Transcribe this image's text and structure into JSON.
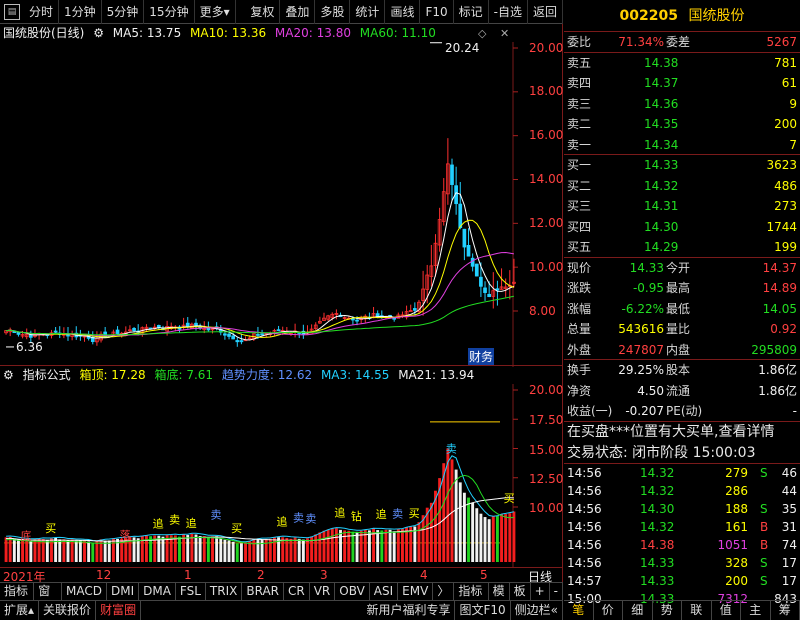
{
  "toolbar": {
    "items": [
      "分时",
      "1分钟",
      "5分钟",
      "15分钟",
      "更多",
      "复权",
      "叠加",
      "多股",
      "统计",
      "画线",
      "F10",
      "标记",
      "-自选",
      "返回"
    ]
  },
  "main_legend": {
    "title": "国统股份(日线)",
    "ma5": "MA5: 13.75",
    "ma10": "MA10: 13.36",
    "ma20": "MA20: 13.80",
    "ma60": "MA60: 11.10"
  },
  "main_axis": [
    "20.00",
    "18.00",
    "16.00",
    "14.00",
    "12.00",
    "10.00",
    "8.00"
  ],
  "main_annotations": {
    "high": "20.24",
    "low": "6.36",
    "badge": "财务"
  },
  "sub_legend": {
    "title": "指标公式",
    "top": "箱顶: 17.28",
    "bottom": "箱底: 7.61",
    "trend": "趋势力度: 12.62",
    "ma3": "MA3: 14.55",
    "ma21": "MA21: 13.94"
  },
  "sub_axis": [
    "20.00",
    "17.50",
    "15.00",
    "12.50",
    "10.00"
  ],
  "signals": {
    "buy": "买",
    "sell": "卖",
    "chase": "追",
    "outcome": "落",
    "bottom": "底",
    "diamond": "钻"
  },
  "time_axis": [
    "2021年",
    "12",
    "1",
    "2",
    "3",
    "4",
    "5"
  ],
  "time_axis_right": "日线",
  "tabs1": [
    "指标A",
    "窗口",
    "MACD",
    "DMI",
    "DMA",
    "FSL",
    "TRIX",
    "BRAR",
    "CR",
    "VR",
    "OBV",
    "ASI",
    "EMV",
    "〉",
    "指标B",
    "模",
    "板",
    "+",
    "-"
  ],
  "tabs2": [
    "扩展",
    "关联报价",
    "财富圈",
    "新用户福利专享",
    "图文F10",
    "侧边栏"
  ],
  "rpanel": {
    "code": "002205",
    "name": "国统股份",
    "weibi_label": "委比",
    "weibi": "71.34%",
    "weicha_label": "委差",
    "weicha": "5267",
    "sells": [
      {
        "label": "卖五",
        "price": "14.38",
        "vol": "781"
      },
      {
        "label": "卖四",
        "price": "14.37",
        "vol": "61"
      },
      {
        "label": "卖三",
        "price": "14.36",
        "vol": "9"
      },
      {
        "label": "卖二",
        "price": "14.35",
        "vol": "200"
      },
      {
        "label": "卖一",
        "price": "14.34",
        "vol": "7"
      }
    ],
    "buys": [
      {
        "label": "买一",
        "price": "14.33",
        "vol": "3623"
      },
      {
        "label": "买二",
        "price": "14.32",
        "vol": "486"
      },
      {
        "label": "买三",
        "price": "14.31",
        "vol": "273"
      },
      {
        "label": "买四",
        "price": "14.30",
        "vol": "1744"
      },
      {
        "label": "买五",
        "price": "14.29",
        "vol": "199"
      }
    ],
    "quote": [
      {
        "l1": "现价",
        "v1": "14.33",
        "l2": "今开",
        "v2": "14.37"
      },
      {
        "l1": "涨跌",
        "v1": "-0.95",
        "l2": "最高",
        "v2": "14.89"
      },
      {
        "l1": "涨幅",
        "v1": "-6.22%",
        "l2": "最低",
        "v2": "14.05"
      },
      {
        "l1": "总量",
        "v1": "543616",
        "l2": "量比",
        "v2": "0.92"
      },
      {
        "l1": "外盘",
        "v1": "247807",
        "l2": "内盘",
        "v2": "295809"
      }
    ],
    "stats": [
      {
        "l1": "换手",
        "v1": "29.25%",
        "l2": "股本",
        "v2": "1.86亿"
      },
      {
        "l1": "净资",
        "v1": "4.50",
        "l2": "流通",
        "v2": "1.86亿"
      },
      {
        "l1": "收益(一)",
        "v1": "-0.207",
        "l2": "PE(动)",
        "v2": "-"
      }
    ],
    "notice1": "在买盘***位置有大买单,查看详情",
    "notice2": "交易状态: 闭市阶段 15:00:03",
    "ticks": [
      {
        "t": "14:56",
        "p": "14.32",
        "v": "279",
        "d": "S",
        "n": "46"
      },
      {
        "t": "14:56",
        "p": "14.32",
        "v": "286",
        "d": "",
        "n": "44"
      },
      {
        "t": "14:56",
        "p": "14.30",
        "v": "188",
        "d": "S",
        "n": "35"
      },
      {
        "t": "14:56",
        "p": "14.32",
        "v": "161",
        "d": "B",
        "n": "31"
      },
      {
        "t": "14:56",
        "p": "14.38",
        "v": "1051",
        "d": "B",
        "n": "74"
      },
      {
        "t": "14:56",
        "p": "14.33",
        "v": "328",
        "d": "S",
        "n": "17"
      },
      {
        "t": "14:57",
        "p": "14.33",
        "v": "200",
        "d": "S",
        "n": "17"
      },
      {
        "t": "15:00",
        "p": "14.33",
        "v": "7312",
        "d": "",
        "n": "843"
      }
    ],
    "tabs": [
      "笔",
      "价",
      "细",
      "势",
      "联",
      "值",
      "主",
      "筹"
    ]
  }
}
